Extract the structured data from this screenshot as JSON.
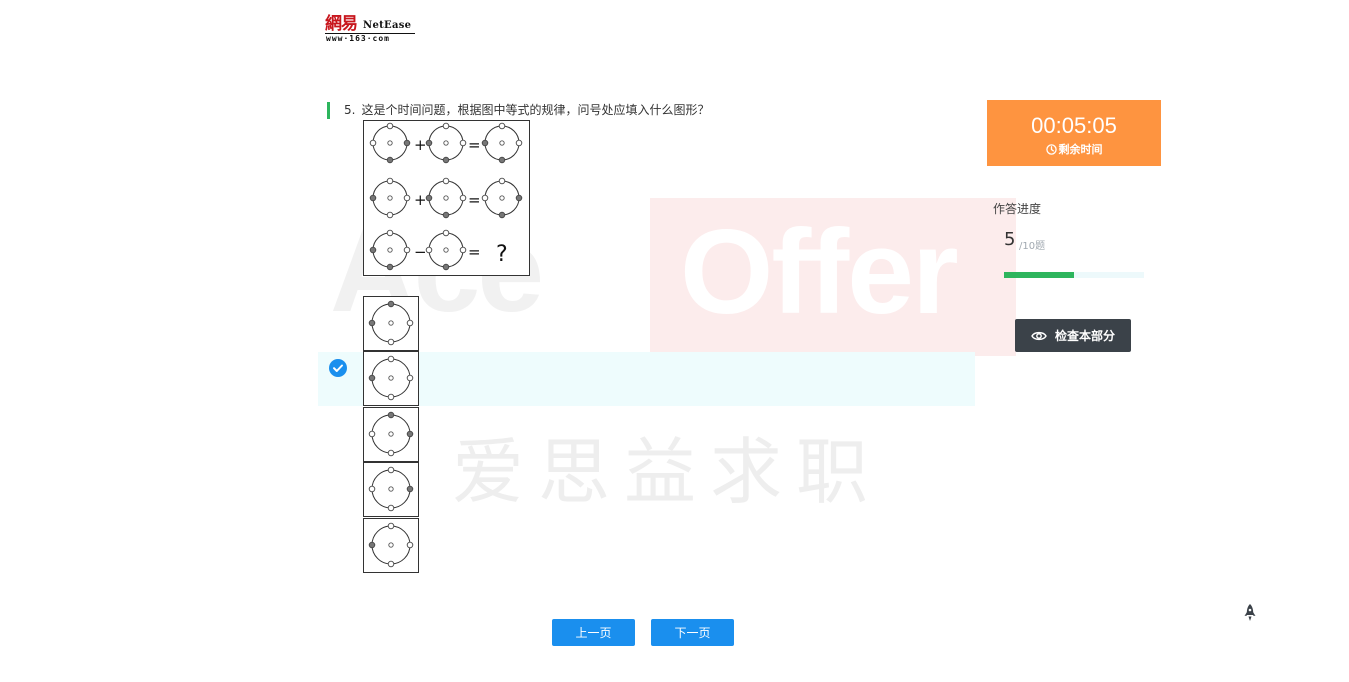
{
  "logo": {
    "cn": "網易",
    "en": "NetEase",
    "url": "www·163·com"
  },
  "watermark": {
    "left": "Ace",
    "right": "Offer",
    "cn": "爱思益求职"
  },
  "question": {
    "number": "5.",
    "text": "这是个时间问题，根据图中等式的规律，问号处应填入什么图形？",
    "operators": [
      "+",
      "=",
      "+",
      "=",
      "−",
      "="
    ],
    "unknown": "?"
  },
  "options": {
    "selected_index": 1,
    "count": 5
  },
  "timer": {
    "time": "00:05:05",
    "label": "剩余时间",
    "color": "#fe9440"
  },
  "progress": {
    "label": "作答进度",
    "current": "5",
    "total": "/10题",
    "fraction": 0.5,
    "color": "#2db55d"
  },
  "review_button": {
    "label": "检查本部分"
  },
  "nav": {
    "prev": "上一页",
    "next": "下一页"
  },
  "icons": [
    "clock-icon",
    "eye-icon",
    "check-circle-icon",
    "rocket-icon"
  ]
}
